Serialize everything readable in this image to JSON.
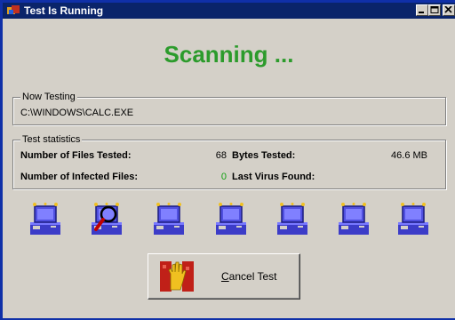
{
  "window": {
    "title": "Test Is Running"
  },
  "headline": "Scanning ...",
  "now_testing": {
    "legend": "Now Testing",
    "path": "C:\\WINDOWS\\CALC.EXE"
  },
  "stats": {
    "legend": "Test statistics",
    "files_tested_label": "Number of Files Tested:",
    "files_tested_value": "68",
    "bytes_tested_label": "Bytes Tested:",
    "bytes_tested_value": "46.6 MB",
    "infected_label": "Number of Infected Files:",
    "infected_value": "0",
    "last_virus_label": "Last Virus Found:",
    "last_virus_value": ""
  },
  "scan_animation": {
    "computers": [
      "computer-icon",
      "magnifier-computer-icon",
      "computer-icon",
      "computer-icon",
      "computer-icon",
      "computer-icon",
      "computer-icon"
    ],
    "active_index": 1
  },
  "cancel_button": {
    "accel": "C",
    "rest": "ancel Test",
    "icon": "stop-hand-icon"
  },
  "colors": {
    "title_bar": "#0a246a",
    "headline": "#2c9b2c",
    "face": "#d4d0c8",
    "infected_value": "#12a012"
  }
}
